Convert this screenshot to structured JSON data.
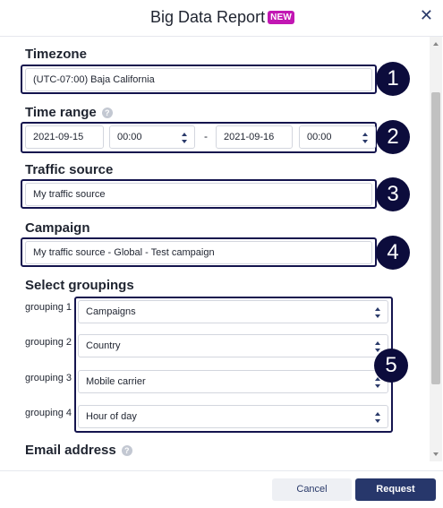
{
  "header": {
    "title": "Big Data Report",
    "badge": "NEW",
    "close_icon": "close-icon"
  },
  "timezone": {
    "label": "Timezone",
    "value": "(UTC-07:00) Baja California",
    "callout": "1"
  },
  "time_range": {
    "label": "Time range",
    "start_date": "2021-09-15",
    "start_time": "00:00",
    "separator": "-",
    "end_date": "2021-09-16",
    "end_time": "00:00",
    "callout": "2"
  },
  "traffic_source": {
    "label": "Traffic source",
    "value": "My traffic source",
    "callout": "3"
  },
  "campaign": {
    "label": "Campaign",
    "value": "My traffic source - Global - Test campaign",
    "callout": "4"
  },
  "groupings": {
    "label": "Select groupings",
    "callout": "5",
    "items": [
      {
        "label": "grouping 1",
        "value": "Campaigns"
      },
      {
        "label": "grouping 2",
        "value": "Country"
      },
      {
        "label": "grouping 3",
        "value": "Mobile carrier"
      },
      {
        "label": "grouping 4",
        "value": "Hour of day"
      }
    ]
  },
  "email": {
    "label": "Email address"
  },
  "footer": {
    "cancel_label": "Cancel",
    "request_label": "Request"
  },
  "colors": {
    "accent": "#27376b",
    "badge": "#c217b3",
    "outline": "#14144e"
  }
}
